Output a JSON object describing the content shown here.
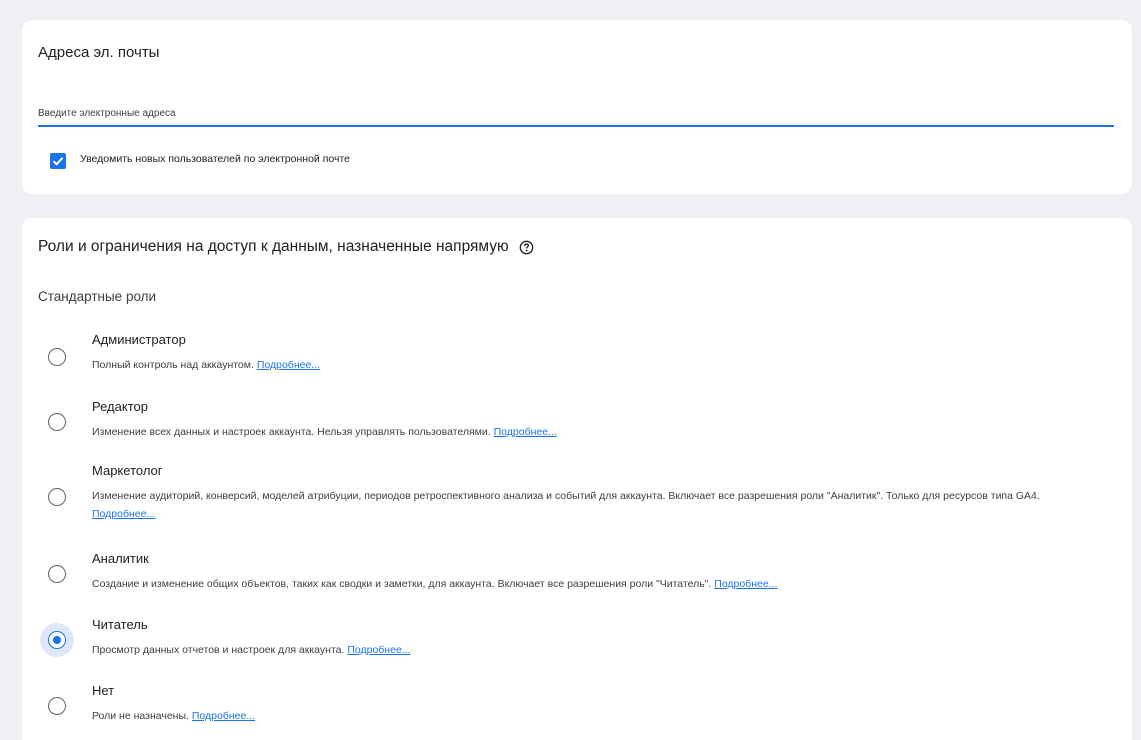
{
  "email_section": {
    "title": "Адреса эл. почты",
    "input_placeholder": "Введите электронные адреса",
    "input_value": "",
    "notify_checkbox_checked": true,
    "notify_label": "Уведомить новых пользователей по электронной почте"
  },
  "roles_section": {
    "title": "Роли и ограничения на доступ к данным, назначенные напрямую",
    "help_icon": "help-circle-icon",
    "standard_roles_label": "Стандартные роли",
    "link_text": "Подробнее...",
    "selected_role": "Читатель",
    "roles": [
      {
        "name": "Администратор",
        "description": "Полный контроль над аккаунтом.",
        "selected": false
      },
      {
        "name": "Редактор",
        "description": "Изменение всех данных и настроек аккаунта. Нельзя управлять пользователями.",
        "selected": false
      },
      {
        "name": "Маркетолог",
        "description": "Изменение аудиторий, конверсий, моделей атрибуции, периодов ретроспективного анализа и событий для аккаунта. Включает все разрешения роли \"Аналитик\". Только для ресурсов типа GA4.",
        "selected": false
      },
      {
        "name": "Аналитик",
        "description": "Создание и изменение общих объектов, таких как сводки и заметки, для аккаунта. Включает все разрешения роли \"Читатель\".",
        "selected": false
      },
      {
        "name": "Читатель",
        "description": "Просмотр данных отчетов и настроек для аккаунта.",
        "selected": true
      },
      {
        "name": "Нет",
        "description": "Роли не назначены.",
        "selected": false
      }
    ]
  },
  "colors": {
    "accent": "#1a73e8",
    "background": "#eef0f3",
    "card": "#ffffff",
    "selected_halo": "#dde7f9"
  }
}
